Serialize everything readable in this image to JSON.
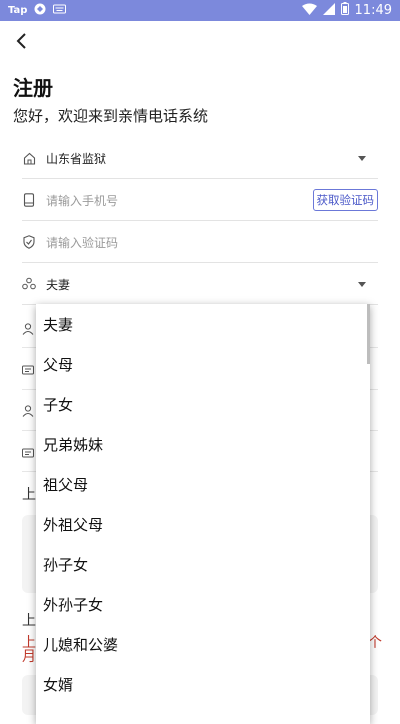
{
  "status_bar": {
    "carrier": "Tap",
    "time": "11:49",
    "icons": [
      "app-icon",
      "keyboard-icon",
      "wifi-icon",
      "signal-icon",
      "battery-icon"
    ]
  },
  "header": {
    "title": "注册",
    "subtitle": "您好，欢迎来到亲情电话系统"
  },
  "form": {
    "prison": {
      "value": "山东省监狱",
      "icon": "home-icon"
    },
    "phone": {
      "placeholder": "请输入手机号",
      "icon": "phone-icon",
      "code_button": "获取验证码"
    },
    "code": {
      "placeholder": "请输入验证码",
      "icon": "shield-icon"
    },
    "relation": {
      "value": "夫妻",
      "icon": "family-icon"
    }
  },
  "background": {
    "label1": "上",
    "label2": "上",
    "red_text_left1": "上",
    "red_text_left2": "月",
    "red_text_right": "个"
  },
  "dropdown": {
    "options": [
      "夫妻",
      "父母",
      "子女",
      "兄弟姊妹",
      "祖父母",
      "外祖父母",
      "孙子女",
      "外孙子女",
      "儿媳和公婆",
      "女婿"
    ]
  },
  "colors": {
    "status_bar": "#7c89dc",
    "accent": "#4a58c8",
    "warning_text": "#c0392b"
  }
}
